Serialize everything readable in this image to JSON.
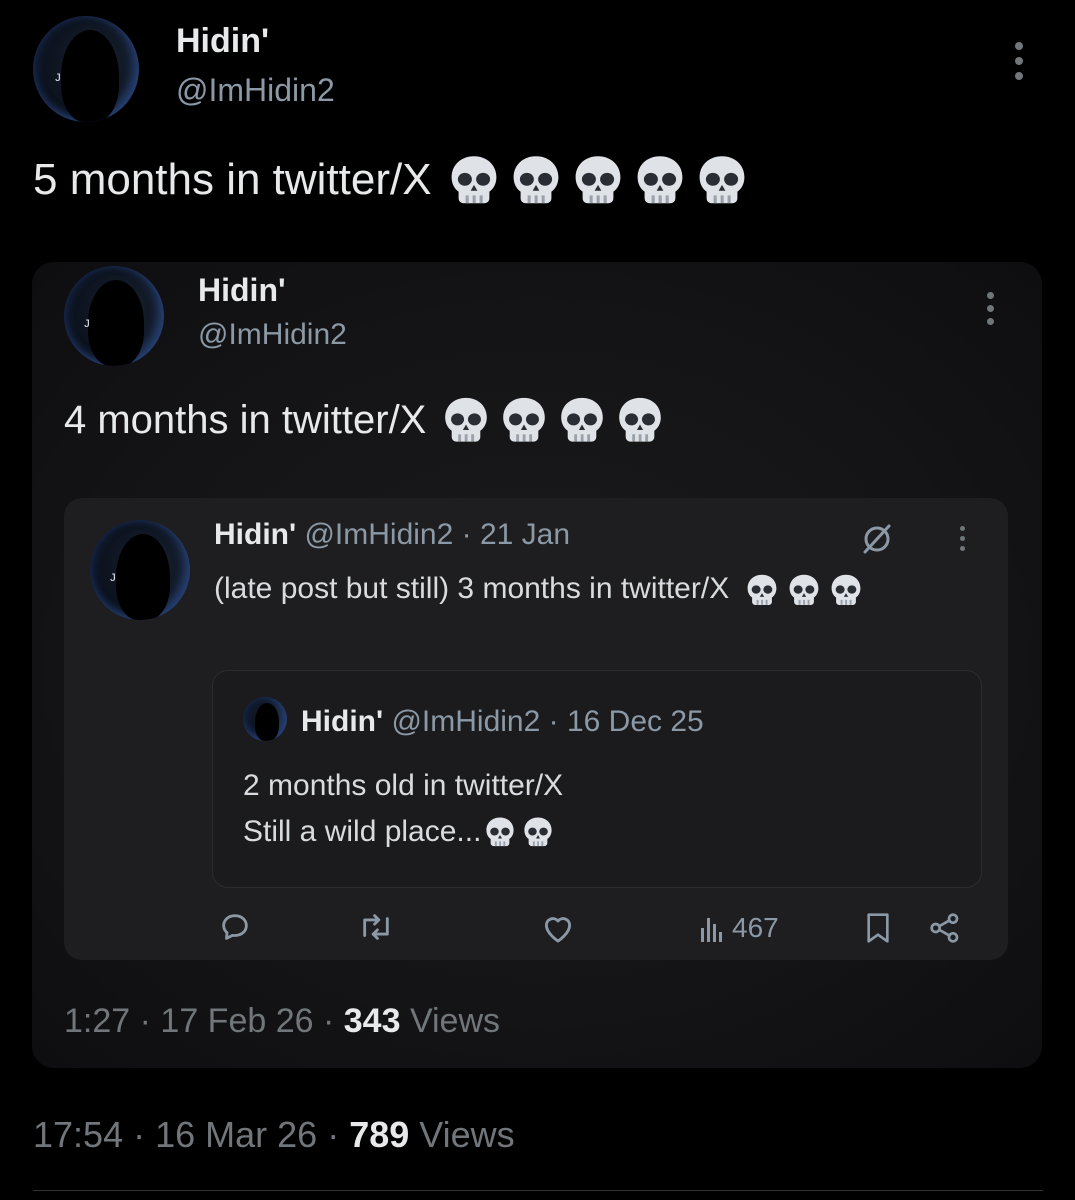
{
  "outer": {
    "name": "Hidin'",
    "handle": "@ImHidin2",
    "text": "5 months in twitter/X",
    "skull_count": 5,
    "time": "17:54",
    "date": "16 Mar 26",
    "views_count": "789",
    "views_label": "Views"
  },
  "quote1": {
    "name": "Hidin'",
    "handle": "@ImHidin2",
    "text": "4 months in twitter/X",
    "skull_count": 4,
    "time": "1:27",
    "date": "17 Feb 26",
    "views_count": "343",
    "views_label": "Views"
  },
  "quote2": {
    "name": "Hidin'",
    "handle": "@ImHidin2",
    "date": "21 Jan",
    "text": "(late post but still) 3 months in twitter/X",
    "skull_count": 3,
    "views": "467"
  },
  "quote3": {
    "name": "Hidin'",
    "handle": "@ImHidin2",
    "date": "16 Dec 25",
    "line1": "2 months old in twitter/X",
    "line2": "Still a wild place...",
    "skull_count": 2
  },
  "icons": [
    "skull-icon",
    "more-icon",
    "reply-icon",
    "repost-icon",
    "like-icon",
    "views-icon",
    "bookmark-icon",
    "share-icon",
    "grok-icon"
  ]
}
